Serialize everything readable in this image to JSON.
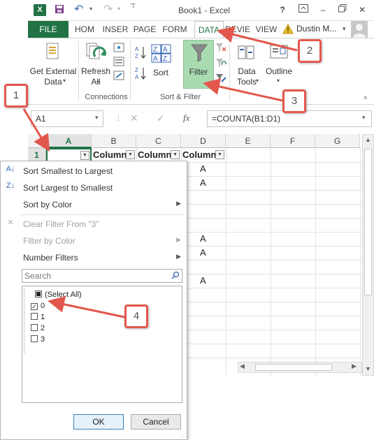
{
  "window": {
    "title": "Book1 - Excel",
    "help": "?",
    "minimize": "–",
    "close": "✕"
  },
  "tabs": [
    {
      "label": "FILE"
    },
    {
      "label": "HOM"
    },
    {
      "label": "INSER"
    },
    {
      "label": "PAGE"
    },
    {
      "label": "FORM"
    },
    {
      "label": "DATA"
    },
    {
      "label": "REVIE"
    },
    {
      "label": "VIEW"
    }
  ],
  "user": {
    "name": "Dustin M..."
  },
  "ribbon": {
    "get_external_data": "Get External Data",
    "refresh_all": "Refresh All",
    "connections_group": "Connections",
    "sort": "Sort",
    "filter": "Filter",
    "data_tools": "Data Tools",
    "outline": "Outline",
    "sort_filter_group": "Sort & Filter"
  },
  "formula_bar": {
    "name_box": "A1",
    "fx": "fx",
    "formula": "=COUNTA(B1:D1)"
  },
  "grid": {
    "columns": [
      "A",
      "B",
      "C",
      "D",
      "E",
      "F",
      "G"
    ],
    "row1": {
      "label": "1",
      "b": "Column",
      "c": "Column",
      "d": "Column"
    },
    "d_values": [
      "A",
      "A",
      "A",
      "A",
      "A"
    ]
  },
  "filter_menu": {
    "sort_smallest": "Sort Smallest to Largest",
    "sort_largest": "Sort Largest to Smallest",
    "sort_color": "Sort by Color",
    "clear_filter": "Clear Filter From \"3\"",
    "filter_color": "Filter by Color",
    "number_filters": "Number Filters",
    "search_placeholder": "Search",
    "items": [
      {
        "label": "(Select All)",
        "checked": "partial"
      },
      {
        "label": "0",
        "checked": "true"
      },
      {
        "label": "1",
        "checked": "false"
      },
      {
        "label": "2",
        "checked": "false"
      },
      {
        "label": "3",
        "checked": "false"
      }
    ],
    "ok": "OK",
    "cancel": "Cancel"
  },
  "callouts": [
    "1",
    "2",
    "3",
    "4"
  ],
  "colors": {
    "excel_green": "#217346",
    "callout_red": "#e2574c",
    "filter_active": "#a9dbb1"
  }
}
